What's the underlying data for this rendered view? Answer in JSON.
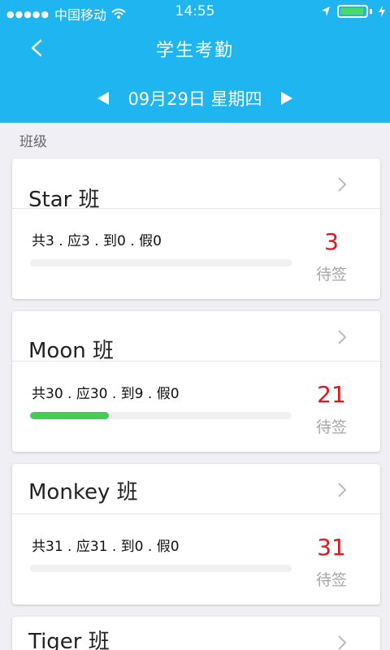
{
  "status_bar": {
    "carrier": "中国移动",
    "time": "14:55"
  },
  "header": {
    "title": "学生考勤",
    "date": "09月29日 星期四"
  },
  "section_label": "班级",
  "colors": {
    "header_bg": "#1eb5f0",
    "count_red": "#e8121b",
    "progress_green": "#44cc55"
  },
  "classes": [
    {
      "name": "Star 班",
      "stats": "共3 . 应3 . 到0 . 假0",
      "count": "3",
      "pending": "待签",
      "progress": 0.0
    },
    {
      "name": "Moon 班",
      "stats": "共30 . 应30 . 到9 . 假0",
      "count": "21",
      "pending": "待签",
      "progress": 0.3
    },
    {
      "name": "Monkey 班",
      "stats": "共31 . 应31 . 到0 . 假0",
      "count": "31",
      "pending": "待签",
      "progress": 0.0
    },
    {
      "name": "Tiger 班"
    }
  ]
}
